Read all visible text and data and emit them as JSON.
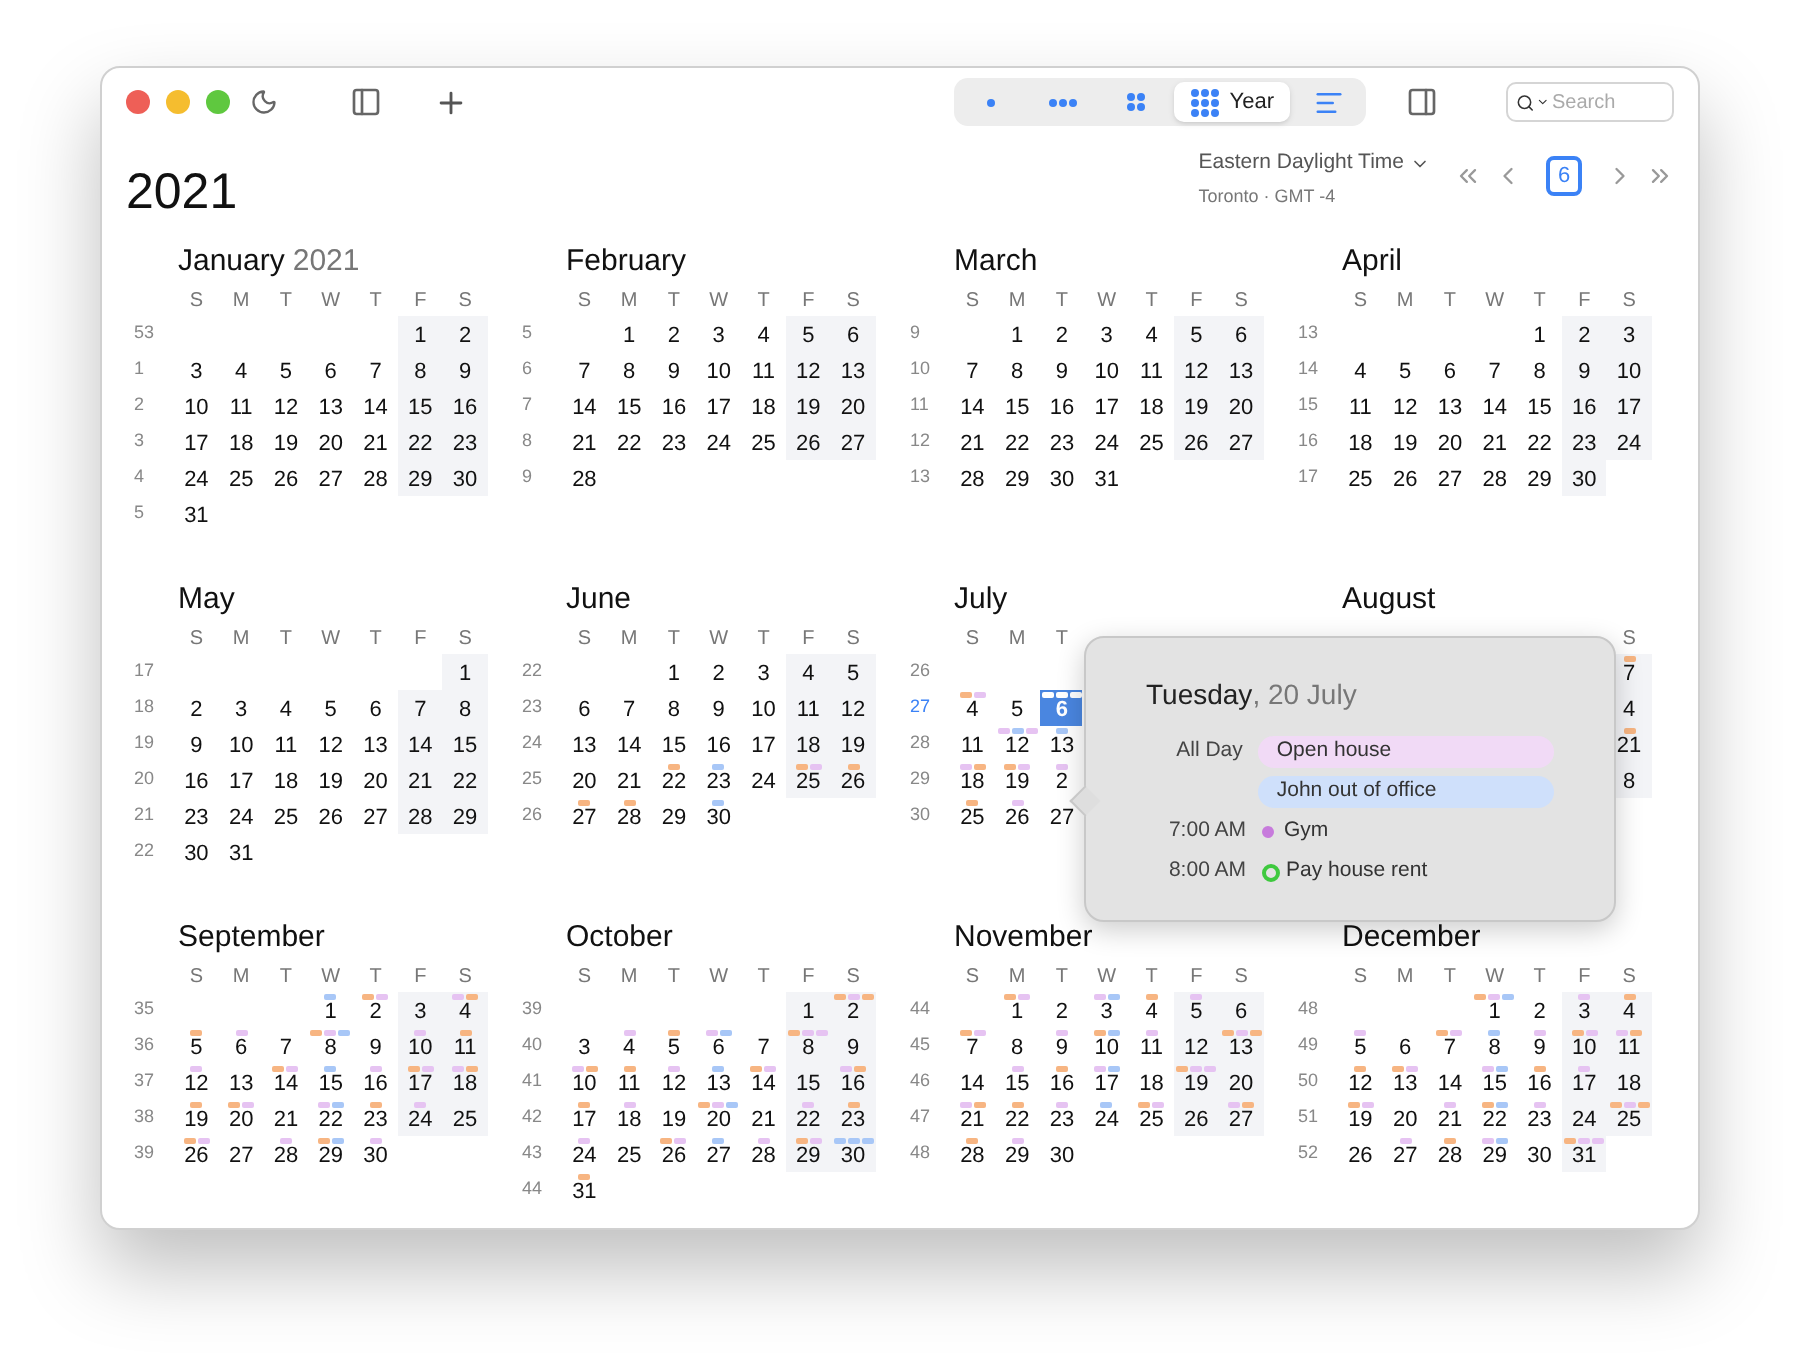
{
  "toolbar": {
    "views": [
      {
        "kind": "day",
        "selected": false
      },
      {
        "kind": "week",
        "selected": false
      },
      {
        "kind": "month",
        "selected": false
      },
      {
        "kind": "year",
        "label": "Year",
        "selected": true
      },
      {
        "kind": "list",
        "selected": false
      }
    ],
    "search": {
      "placeholder": "Search"
    }
  },
  "header": {
    "year": "2021",
    "timezone": "Eastern Daylight Time",
    "location": "Toronto · GMT -4",
    "today": "6"
  },
  "months": [
    {
      "name": "January",
      "year": "2021",
      "weekdays": [
        "S",
        "M",
        "T",
        "W",
        "T",
        "F",
        "S"
      ],
      "weeks": [
        {
          "number": "53",
          "current": false,
          "days": [
            "1",
            "2"
          ]
        },
        {
          "number": "1",
          "current": false,
          "days": [
            "3",
            "4",
            "5",
            "6",
            "7",
            "8",
            "9"
          ]
        },
        {
          "number": "2",
          "current": false,
          "days": [
            "10",
            "11",
            "12",
            "13",
            "14",
            "15",
            "16"
          ]
        },
        {
          "number": "3",
          "current": false,
          "days": [
            "17",
            "18",
            "19",
            "20",
            "21",
            "22",
            "23"
          ]
        },
        {
          "number": "4",
          "current": false,
          "days": [
            "24",
            "25",
            "26",
            "27",
            "28",
            "29",
            "30"
          ]
        },
        {
          "number": "5",
          "current": false,
          "days": [
            "31"
          ]
        }
      ]
    },
    {
      "name": "February",
      "weekdays": [
        "S",
        "M",
        "T",
        "W",
        "T",
        "F",
        "S"
      ],
      "weeks": [
        {
          "number": "5",
          "current": false,
          "days": [
            "1",
            "2",
            "3",
            "4",
            "5",
            "6"
          ]
        },
        {
          "number": "6",
          "current": false,
          "days": [
            "7",
            "8",
            "9",
            "10",
            "11",
            "12",
            "13"
          ]
        },
        {
          "number": "7",
          "current": false,
          "days": [
            "14",
            "15",
            "16",
            "17",
            "18",
            "19",
            "20"
          ]
        },
        {
          "number": "8",
          "current": false,
          "days": [
            "21",
            "22",
            "23",
            "24",
            "25",
            "26",
            "27"
          ]
        },
        {
          "number": "9",
          "current": false,
          "days": [
            "28"
          ]
        }
      ]
    },
    {
      "name": "March",
      "weekdays": [
        "S",
        "M",
        "T",
        "W",
        "T",
        "F",
        "S"
      ],
      "weeks": [
        {
          "number": "9",
          "current": false,
          "days": [
            "1",
            "2",
            "3",
            "4",
            "5",
            "6"
          ]
        },
        {
          "number": "10",
          "current": false,
          "days": [
            "7",
            "8",
            "9",
            "10",
            "11",
            "12",
            "13"
          ]
        },
        {
          "number": "11",
          "current": false,
          "days": [
            "14",
            "15",
            "16",
            "17",
            "18",
            "19",
            "20"
          ]
        },
        {
          "number": "12",
          "current": false,
          "days": [
            "21",
            "22",
            "23",
            "24",
            "25",
            "26",
            "27"
          ]
        },
        {
          "number": "13",
          "current": false,
          "days": [
            "28",
            "29",
            "30",
            "31"
          ]
        }
      ]
    },
    {
      "name": "April",
      "weekdays": [
        "S",
        "M",
        "T",
        "W",
        "T",
        "F",
        "S"
      ],
      "weeks": [
        {
          "number": "13",
          "current": false,
          "days": [
            "1",
            "2",
            "3"
          ]
        },
        {
          "number": "14",
          "current": false,
          "days": [
            "4",
            "5",
            "6",
            "7",
            "8",
            "9",
            "10"
          ]
        },
        {
          "number": "15",
          "current": false,
          "days": [
            "11",
            "12",
            "13",
            "14",
            "15",
            "16",
            "17"
          ]
        },
        {
          "number": "16",
          "current": false,
          "days": [
            "18",
            "19",
            "20",
            "21",
            "22",
            "23",
            "24"
          ]
        },
        {
          "number": "17",
          "current": false,
          "days": [
            "25",
            "26",
            "27",
            "28",
            "29",
            "30"
          ]
        }
      ]
    },
    {
      "name": "May",
      "weekdays": [
        "S",
        "M",
        "T",
        "W",
        "T",
        "F",
        "S"
      ],
      "weeks": [
        {
          "number": "17",
          "current": false,
          "days": [
            "1"
          ]
        },
        {
          "number": "18",
          "current": false,
          "days": [
            "2",
            "3",
            "4",
            "5",
            "6",
            "7",
            "8"
          ]
        },
        {
          "number": "19",
          "current": false,
          "days": [
            "9",
            "10",
            "11",
            "12",
            "13",
            "14",
            "15"
          ]
        },
        {
          "number": "20",
          "current": false,
          "days": [
            "16",
            "17",
            "18",
            "19",
            "20",
            "21",
            "22"
          ]
        },
        {
          "number": "21",
          "current": false,
          "days": [
            "23",
            "24",
            "25",
            "26",
            "27",
            "28",
            "29"
          ]
        },
        {
          "number": "22",
          "current": false,
          "days": [
            "30",
            "31"
          ]
        }
      ]
    },
    {
      "name": "June",
      "weekdays": [
        "S",
        "M",
        "T",
        "W",
        "T",
        "F",
        "S"
      ],
      "weeks": [
        {
          "number": "22",
          "current": false,
          "days": [
            "1",
            "2",
            "3",
            "4",
            "5"
          ]
        },
        {
          "number": "23",
          "current": false,
          "days": [
            "6",
            "7",
            "8",
            "9",
            "10",
            "11",
            "12"
          ]
        },
        {
          "number": "24",
          "current": false,
          "days": [
            "13",
            "14",
            "15",
            "16",
            "17",
            "18",
            "19"
          ]
        },
        {
          "number": "25",
          "current": false,
          "days": [
            "20",
            "21",
            {
              "text": "22",
              "marks": [
                {
                  "color": "#f7b582"
                }
              ]
            },
            {
              "text": "23",
              "marks": [
                {
                  "color": "#a8c7f7"
                }
              ]
            },
            "24",
            {
              "text": "25",
              "marks": [
                {
                  "color": "#f7b582"
                },
                {
                  "color": "#e6c3f2"
                }
              ]
            },
            {
              "text": "26",
              "marks": [
                {
                  "color": "#f7b582"
                }
              ]
            }
          ]
        },
        {
          "number": "26",
          "current": false,
          "days": [
            {
              "text": "27",
              "marks": [
                {
                  "color": "#f7b582"
                }
              ]
            },
            {
              "text": "28",
              "marks": [
                {
                  "color": "#f7b582"
                }
              ]
            },
            "29",
            {
              "text": "30",
              "marks": [
                {
                  "color": "#a8c7f7"
                }
              ]
            }
          ]
        }
      ]
    },
    {
      "name": "July",
      "weekdays": [
        "S",
        "M",
        "T"
      ],
      "weeks": [
        {
          "number": "26",
          "current": false
        },
        {
          "number": "27",
          "current": true,
          "days": [
            {
              "text": "4",
              "marks": [
                {
                  "color": "#f7b582"
                },
                {
                  "color": "#e6c3f2"
                }
              ]
            },
            "5",
            {
              "text": "6",
              "selected": true,
              "marks": [
                {
                  "color": "#ffffff"
                },
                {
                  "color": "#ffffff"
                },
                {
                  "color": "#ffffff"
                }
              ]
            }
          ]
        },
        {
          "number": "28",
          "current": false,
          "days": [
            "11",
            {
              "text": "12",
              "marks": [
                {
                  "color": "#e6c3f2"
                },
                {
                  "color": "#a8c7f7"
                },
                {
                  "color": "#e6c3f2"
                }
              ]
            },
            {
              "text": "13",
              "marks": [
                {
                  "color": "#a8c7f7"
                }
              ]
            }
          ]
        },
        {
          "number": "29",
          "current": false,
          "days": [
            {
              "text": "18",
              "marks": [
                {
                  "color": "#e6c3f2"
                },
                {
                  "color": "#f7b582"
                }
              ]
            },
            {
              "text": "19",
              "marks": [
                {
                  "color": "#f7b582"
                },
                {
                  "color": "#e6c3f2"
                }
              ]
            },
            {
              "text": "2",
              "marks": [
                {
                  "color": "#e6c3f2"
                }
              ]
            }
          ]
        },
        {
          "number": "30",
          "current": false,
          "days": [
            {
              "text": "25",
              "marks": [
                {
                  "color": "#f7b582"
                }
              ]
            },
            {
              "text": "26",
              "marks": [
                {
                  "color": "#e6c3f2"
                }
              ]
            },
            "27"
          ]
        }
      ]
    },
    {
      "name": "August",
      "cut_left": true,
      "weekdays": [
        "S"
      ],
      "weeks": [
        {
          "days": [
            {
              "text": "7",
              "marks": [
                {
                  "color": "#f7b582"
                }
              ]
            }
          ]
        },
        {
          "days": [
            "4"
          ]
        },
        {
          "days": [
            {
              "text": "21",
              "marks": [
                {
                  "color": "#f7b582"
                }
              ]
            }
          ]
        },
        {
          "days": [
            "8"
          ]
        }
      ]
    },
    {
      "name": "September",
      "weekdays": [
        "S",
        "M",
        "T",
        "W",
        "T",
        "F",
        "S"
      ],
      "weeks": [
        {
          "number": "35",
          "current": false,
          "days": [
            {
              "text": "1",
              "marks": [
                {
                  "color": "#a8c7f7"
                }
              ]
            },
            {
              "text": "2",
              "marks": [
                {
                  "color": "#f7b582"
                },
                {
                  "color": "#e6c3f2"
                }
              ]
            },
            "3",
            {
              "text": "4",
              "marks": [
                {
                  "color": "#e6c3f2"
                },
                {
                  "color": "#f7b582"
                }
              ]
            }
          ]
        },
        {
          "number": "36",
          "current": false,
          "days": [
            {
              "text": "5",
              "marks": [
                {
                  "color": "#f7b582"
                }
              ]
            },
            {
              "text": "6",
              "marks": [
                {
                  "color": "#e6c3f2"
                }
              ]
            },
            "7",
            {
              "text": "8",
              "marks": [
                {
                  "color": "#f7b582"
                },
                {
                  "color": "#e6c3f2"
                },
                {
                  "color": "#a8c7f7"
                }
              ]
            },
            "9",
            {
              "text": "10",
              "marks": [
                {
                  "color": "#e6c3f2"
                }
              ]
            },
            {
              "text": "11",
              "marks": [
                {
                  "color": "#f7b582"
                }
              ]
            }
          ]
        },
        {
          "number": "37",
          "current": false,
          "days": [
            {
              "text": "12",
              "marks": [
                {
                  "color": "#e6c3f2"
                }
              ]
            },
            "13",
            {
              "text": "14",
              "marks": [
                {
                  "color": "#f7b582"
                },
                {
                  "color": "#e6c3f2"
                }
              ]
            },
            {
              "text": "15",
              "marks": [
                {
                  "color": "#a8c7f7"
                }
              ]
            },
            {
              "text": "16",
              "marks": [
                {
                  "color": "#e6c3f2"
                }
              ]
            },
            {
              "text": "17",
              "marks": [
                {
                  "color": "#f7b582"
                },
                {
                  "color": "#e6c3f2"
                }
              ]
            },
            {
              "text": "18",
              "marks": [
                {
                  "color": "#e6c3f2"
                },
                {
                  "color": "#f7b582"
                }
              ]
            }
          ]
        },
        {
          "number": "38",
          "current": false,
          "days": [
            {
              "text": "19",
              "marks": [
                {
                  "color": "#f7b582"
                }
              ]
            },
            {
              "text": "20",
              "marks": [
                {
                  "color": "#f7b582"
                },
                {
                  "color": "#e6c3f2"
                }
              ]
            },
            "21",
            {
              "text": "22",
              "marks": [
                {
                  "color": "#e6c3f2"
                },
                {
                  "color": "#a8c7f7"
                }
              ]
            },
            {
              "text": "23",
              "marks": [
                {
                  "color": "#f7b582"
                }
              ]
            },
            {
              "text": "24",
              "marks": [
                {
                  "color": "#e6c3f2"
                }
              ]
            },
            "25"
          ]
        },
        {
          "number": "39",
          "current": false,
          "days": [
            {
              "text": "26",
              "marks": [
                {
                  "color": "#f7b582"
                },
                {
                  "color": "#e6c3f2"
                }
              ]
            },
            "27",
            {
              "text": "28",
              "marks": [
                {
                  "color": "#e6c3f2"
                }
              ]
            },
            {
              "text": "29",
              "marks": [
                {
                  "color": "#f7b582"
                },
                {
                  "color": "#a8c7f7"
                }
              ]
            },
            {
              "text": "30",
              "marks": [
                {
                  "color": "#e6c3f2"
                }
              ]
            }
          ]
        }
      ]
    },
    {
      "name": "October",
      "weekdays": [
        "S",
        "M",
        "T",
        "W",
        "T",
        "F",
        "S"
      ],
      "weeks": [
        {
          "number": "39",
          "current": false,
          "days": [
            "1",
            {
              "text": "2",
              "marks": [
                {
                  "color": "#f7b582"
                },
                {
                  "color": "#e6c3f2"
                },
                {
                  "color": "#f7b582"
                }
              ]
            }
          ]
        },
        {
          "number": "40",
          "current": false,
          "days": [
            "3",
            {
              "text": "4",
              "marks": [
                {
                  "color": "#e6c3f2"
                }
              ]
            },
            {
              "text": "5",
              "marks": [
                {
                  "color": "#f7b582"
                }
              ]
            },
            {
              "text": "6",
              "marks": [
                {
                  "color": "#e6c3f2"
                },
                {
                  "color": "#a8c7f7"
                }
              ]
            },
            "7",
            {
              "text": "8",
              "marks": [
                {
                  "color": "#f7b582"
                },
                {
                  "color": "#e6c3f2"
                },
                {
                  "color": "#e6c3f2"
                }
              ]
            },
            "9"
          ]
        },
        {
          "number": "41",
          "current": false,
          "days": [
            {
              "text": "10",
              "marks": [
                {
                  "color": "#e6c3f2"
                },
                {
                  "color": "#f7b582"
                }
              ]
            },
            {
              "text": "11",
              "marks": [
                {
                  "color": "#f7b582"
                }
              ]
            },
            {
              "text": "12",
              "marks": [
                {
                  "color": "#e6c3f2"
                }
              ]
            },
            {
              "text": "13",
              "marks": [
                {
                  "color": "#a8c7f7"
                }
              ]
            },
            {
              "text": "14",
              "marks": [
                {
                  "color": "#f7b582"
                },
                {
                  "color": "#e6c3f2"
                }
              ]
            },
            "15",
            {
              "text": "16",
              "marks": [
                {
                  "color": "#e6c3f2"
                },
                {
                  "color": "#f7b582"
                }
              ]
            }
          ]
        },
        {
          "number": "42",
          "current": false,
          "days": [
            {
              "text": "17",
              "marks": [
                {
                  "color": "#f7b582"
                }
              ]
            },
            {
              "text": "18",
              "marks": [
                {
                  "color": "#e6c3f2"
                }
              ]
            },
            "19",
            {
              "text": "20",
              "marks": [
                {
                  "color": "#f7b582"
                },
                {
                  "color": "#e6c3f2"
                },
                {
                  "color": "#a8c7f7"
                }
              ]
            },
            "21",
            {
              "text": "22",
              "marks": [
                {
                  "color": "#e6c3f2"
                }
              ]
            },
            {
              "text": "23",
              "marks": [
                {
                  "color": "#f7b582"
                }
              ]
            }
          ]
        },
        {
          "number": "43",
          "current": false,
          "days": [
            {
              "text": "24",
              "marks": [
                {
                  "color": "#e6c3f2"
                }
              ]
            },
            "25",
            {
              "text": "26",
              "marks": [
                {
                  "color": "#f7b582"
                },
                {
                  "color": "#e6c3f2"
                }
              ]
            },
            {
              "text": "27",
              "marks": [
                {
                  "color": "#a8c7f7"
                }
              ]
            },
            {
              "text": "28",
              "marks": [
                {
                  "color": "#e6c3f2"
                }
              ]
            },
            {
              "text": "29",
              "marks": [
                {
                  "color": "#f7b582"
                },
                {
                  "color": "#e6c3f2"
                }
              ]
            },
            {
              "text": "30",
              "marks": [
                {
                  "color": "#a8c7f7"
                },
                {
                  "color": "#a8c7f7"
                },
                {
                  "color": "#a8c7f7"
                }
              ]
            }
          ]
        },
        {
          "number": "44",
          "current": false,
          "days": [
            {
              "text": "31",
              "marks": [
                {
                  "color": "#f7b582"
                }
              ]
            }
          ]
        }
      ]
    },
    {
      "name": "November",
      "weekdays": [
        "S",
        "M",
        "T",
        "W",
        "T",
        "F",
        "S"
      ],
      "weeks": [
        {
          "number": "44",
          "current": false,
          "days": [
            {
              "text": "1",
              "marks": [
                {
                  "color": "#f7b582"
                },
                {
                  "color": "#e6c3f2"
                }
              ]
            },
            "2",
            {
              "text": "3",
              "marks": [
                {
                  "color": "#e6c3f2"
                },
                {
                  "color": "#a8c7f7"
                }
              ]
            },
            {
              "text": "4",
              "marks": [
                {
                  "color": "#f7b582"
                }
              ]
            },
            {
              "text": "5",
              "marks": [
                {
                  "color": "#e6c3f2"
                }
              ]
            },
            "6"
          ]
        },
        {
          "number": "45",
          "current": false,
          "days": [
            {
              "text": "7",
              "marks": [
                {
                  "color": "#f7b582"
                },
                {
                  "color": "#e6c3f2"
                }
              ]
            },
            "8",
            {
              "text": "9",
              "marks": [
                {
                  "color": "#e6c3f2"
                }
              ]
            },
            {
              "text": "10",
              "marks": [
                {
                  "color": "#f7b582"
                },
                {
                  "color": "#a8c7f7"
                }
              ]
            },
            {
              "text": "11",
              "marks": [
                {
                  "color": "#e6c3f2"
                }
              ]
            },
            "12",
            {
              "text": "13",
              "marks": [
                {
                  "color": "#f7b582"
                },
                {
                  "color": "#e6c3f2"
                },
                {
                  "color": "#f7b582"
                }
              ]
            }
          ]
        },
        {
          "number": "46",
          "current": false,
          "days": [
            "14",
            {
              "text": "15",
              "marks": [
                {
                  "color": "#e6c3f2"
                }
              ]
            },
            {
              "text": "16",
              "marks": [
                {
                  "color": "#f7b582"
                }
              ]
            },
            {
              "text": "17",
              "marks": [
                {
                  "color": "#e6c3f2"
                },
                {
                  "color": "#a8c7f7"
                }
              ]
            },
            "18",
            {
              "text": "19",
              "marks": [
                {
                  "color": "#f7b582"
                },
                {
                  "color": "#e6c3f2"
                },
                {
                  "color": "#e6c3f2"
                }
              ]
            },
            "20"
          ]
        },
        {
          "number": "47",
          "current": false,
          "days": [
            {
              "text": "21",
              "marks": [
                {
                  "color": "#e6c3f2"
                },
                {
                  "color": "#f7b582"
                }
              ]
            },
            {
              "text": "22",
              "marks": [
                {
                  "color": "#f7b582"
                }
              ]
            },
            {
              "text": "23",
              "marks": [
                {
                  "color": "#e6c3f2"
                }
              ]
            },
            {
              "text": "24",
              "marks": [
                {
                  "color": "#a8c7f7"
                }
              ]
            },
            {
              "text": "25",
              "marks": [
                {
                  "color": "#f7b582"
                },
                {
                  "color": "#e6c3f2"
                }
              ]
            },
            "26",
            {
              "text": "27",
              "marks": [
                {
                  "color": "#e6c3f2"
                },
                {
                  "color": "#f7b582"
                }
              ]
            }
          ]
        },
        {
          "number": "48",
          "current": false,
          "days": [
            {
              "text": "28",
              "marks": [
                {
                  "color": "#f7b582"
                }
              ]
            },
            {
              "text": "29",
              "marks": [
                {
                  "color": "#e6c3f2"
                }
              ]
            },
            "30"
          ]
        }
      ]
    },
    {
      "name": "December",
      "weekdays": [
        "S",
        "M",
        "T",
        "W",
        "T",
        "F",
        "S"
      ],
      "weeks": [
        {
          "number": "48",
          "current": false,
          "days": [
            {
              "text": "1",
              "marks": [
                {
                  "color": "#f7b582"
                },
                {
                  "color": "#e6c3f2"
                },
                {
                  "color": "#a8c7f7"
                }
              ]
            },
            "2",
            {
              "text": "3",
              "marks": [
                {
                  "color": "#e6c3f2"
                }
              ]
            },
            {
              "text": "4",
              "marks": [
                {
                  "color": "#f7b582"
                }
              ]
            }
          ]
        },
        {
          "number": "49",
          "current": false,
          "days": [
            {
              "text": "5",
              "marks": [
                {
                  "color": "#e6c3f2"
                }
              ]
            },
            "6",
            {
              "text": "7",
              "marks": [
                {
                  "color": "#f7b582"
                },
                {
                  "color": "#e6c3f2"
                }
              ]
            },
            {
              "text": "8",
              "marks": [
                {
                  "color": "#a8c7f7"
                }
              ]
            },
            {
              "text": "9",
              "marks": [
                {
                  "color": "#e6c3f2"
                }
              ]
            },
            {
              "text": "10",
              "marks": [
                {
                  "color": "#f7b582"
                },
                {
                  "color": "#e6c3f2"
                }
              ]
            },
            {
              "text": "11",
              "marks": [
                {
                  "color": "#e6c3f2"
                },
                {
                  "color": "#f7b582"
                }
              ]
            }
          ]
        },
        {
          "number": "50",
          "current": false,
          "days": [
            {
              "text": "12",
              "marks": [
                {
                  "color": "#f7b582"
                }
              ]
            },
            {
              "text": "13",
              "marks": [
                {
                  "color": "#f7b582"
                },
                {
                  "color": "#e6c3f2"
                }
              ]
            },
            "14",
            {
              "text": "15",
              "marks": [
                {
                  "color": "#e6c3f2"
                },
                {
                  "color": "#a8c7f7"
                }
              ]
            },
            {
              "text": "16",
              "marks": [
                {
                  "color": "#f7b582"
                }
              ]
            },
            {
              "text": "17",
              "marks": [
                {
                  "color": "#e6c3f2"
                }
              ]
            },
            "18"
          ]
        },
        {
          "number": "51",
          "current": false,
          "days": [
            {
              "text": "19",
              "marks": [
                {
                  "color": "#f7b582"
                },
                {
                  "color": "#e6c3f2"
                }
              ]
            },
            "20",
            {
              "text": "21",
              "marks": [
                {
                  "color": "#e6c3f2"
                }
              ]
            },
            {
              "text": "22",
              "marks": [
                {
                  "color": "#f7b582"
                },
                {
                  "color": "#a8c7f7"
                }
              ]
            },
            {
              "text": "23",
              "marks": [
                {
                  "color": "#e6c3f2"
                }
              ]
            },
            "24",
            {
              "text": "25",
              "marks": [
                {
                  "color": "#f7b582"
                },
                {
                  "color": "#e6c3f2"
                },
                {
                  "color": "#f7b582"
                }
              ]
            }
          ]
        },
        {
          "number": "52",
          "current": false,
          "days": [
            "26",
            {
              "text": "27",
              "marks": [
                {
                  "color": "#e6c3f2"
                }
              ]
            },
            {
              "text": "28",
              "marks": [
                {
                  "color": "#f7b582"
                }
              ]
            },
            {
              "text": "29",
              "marks": [
                {
                  "color": "#e6c3f2"
                },
                {
                  "color": "#a8c7f7"
                }
              ]
            },
            "30",
            {
              "text": "31",
              "marks": [
                {
                  "color": "#f7b582"
                },
                {
                  "color": "#e6c3f2"
                },
                {
                  "color": "#e6c3f2"
                }
              ]
            }
          ]
        }
      ]
    }
  ],
  "popover": {
    "weekday": "Tuesday",
    "date": ", 20 July",
    "events": [
      {
        "kind": "allday",
        "time": "All Day",
        "title": "Open house",
        "color": "#f1daf6"
      },
      {
        "kind": "allday",
        "title": "John out of office",
        "color": "#cfe0fb"
      },
      {
        "kind": "timed",
        "time": "7:00 AM",
        "title": "Gym",
        "color": "#c77bdc"
      },
      {
        "kind": "task",
        "time": "8:00 AM",
        "title": "Pay house rent",
        "color": "#3ec93e"
      }
    ]
  }
}
